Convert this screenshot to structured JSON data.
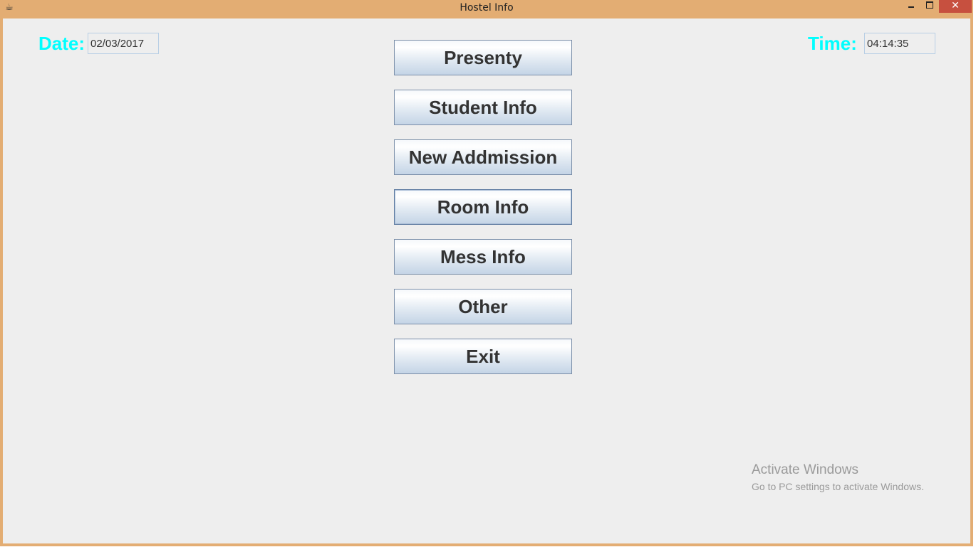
{
  "window": {
    "title": "Hostel Info",
    "close_glyph": "✕",
    "icon": "java-cup-icon",
    "frame_color": "#e3ad73",
    "close_color": "#c7503f"
  },
  "header": {
    "date_label": "Date:",
    "date_value": "02/03/2017",
    "time_label": "Time:",
    "time_value": "04:14:35",
    "label_color": "#00ffff"
  },
  "menu": {
    "presenty": "Presenty",
    "student_info": "Student Info",
    "new_admission": "New Addmission",
    "room_info": "Room Info",
    "mess_info": "Mess Info",
    "other": "Other",
    "exit": "Exit"
  },
  "watermark": {
    "title": "Activate Windows",
    "subtitle": "Go to PC settings to activate Windows."
  }
}
